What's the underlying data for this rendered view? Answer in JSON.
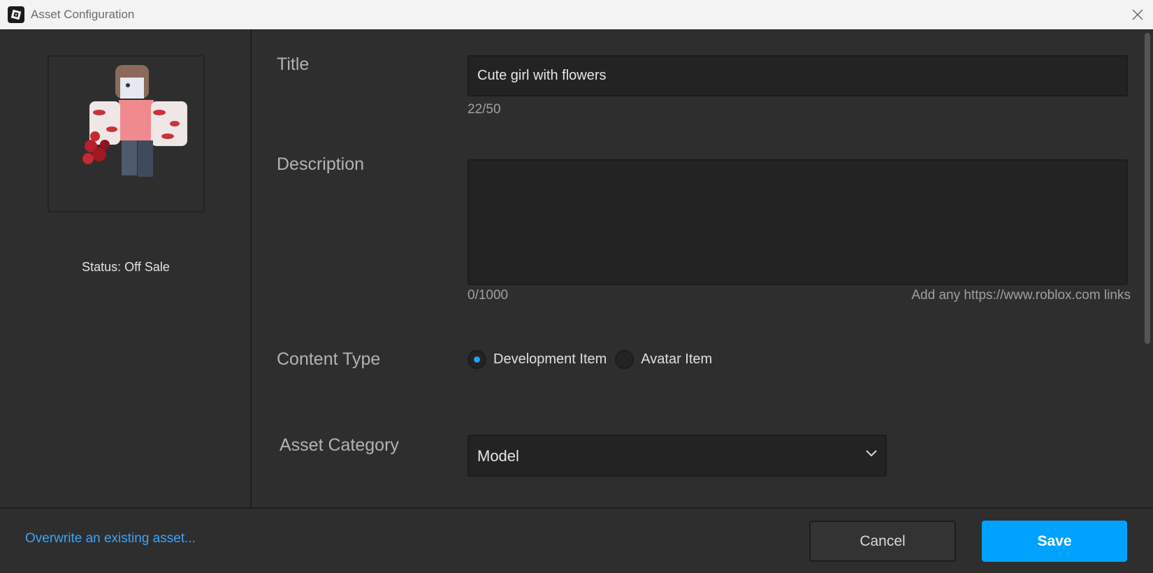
{
  "window": {
    "title": "Asset Configuration"
  },
  "left_panel": {
    "status": "Status: Off Sale"
  },
  "form": {
    "title": {
      "label": "Title",
      "value": "Cute girl with flowers",
      "counter": "22/50"
    },
    "description": {
      "label": "Description",
      "value": "",
      "counter": "0/1000",
      "hint": "Add any https://www.roblox.com links"
    },
    "content_type": {
      "label": "Content Type",
      "options": [
        {
          "label": "Development Item",
          "selected": true
        },
        {
          "label": "Avatar Item",
          "selected": false
        }
      ]
    },
    "asset_category": {
      "label": "Asset Category",
      "value": "Model"
    }
  },
  "footer": {
    "overwrite_link": "Overwrite an existing asset...",
    "cancel_label": "Cancel",
    "save_label": "Save"
  },
  "colors": {
    "accent": "#00a2ff",
    "link": "#3ba4ff",
    "background": "#2e2e2e",
    "input_bg": "#232323"
  }
}
